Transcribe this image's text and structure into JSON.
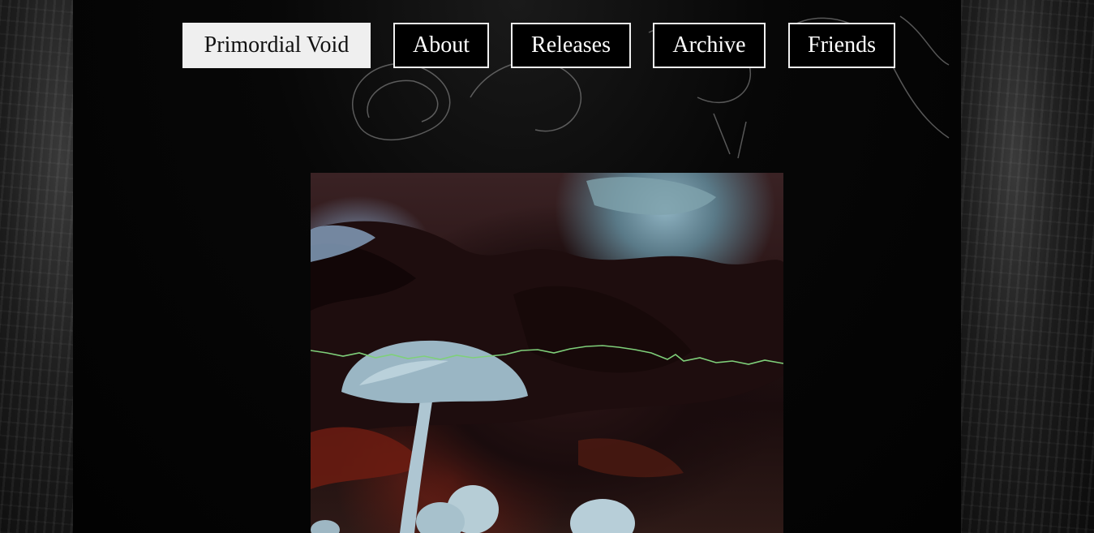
{
  "nav": {
    "items": [
      {
        "label": "Primordial Void",
        "active": true
      },
      {
        "label": "About",
        "active": false
      },
      {
        "label": "Releases",
        "active": false
      },
      {
        "label": "Archive",
        "active": false
      },
      {
        "label": "Friends",
        "active": false
      }
    ]
  },
  "media": {
    "subject": "mushroom-video",
    "waveform_color": "#7fd07a"
  },
  "colors": {
    "background": "#050505",
    "nav_border": "#f0f0f0",
    "nav_active_bg": "#efefef"
  }
}
